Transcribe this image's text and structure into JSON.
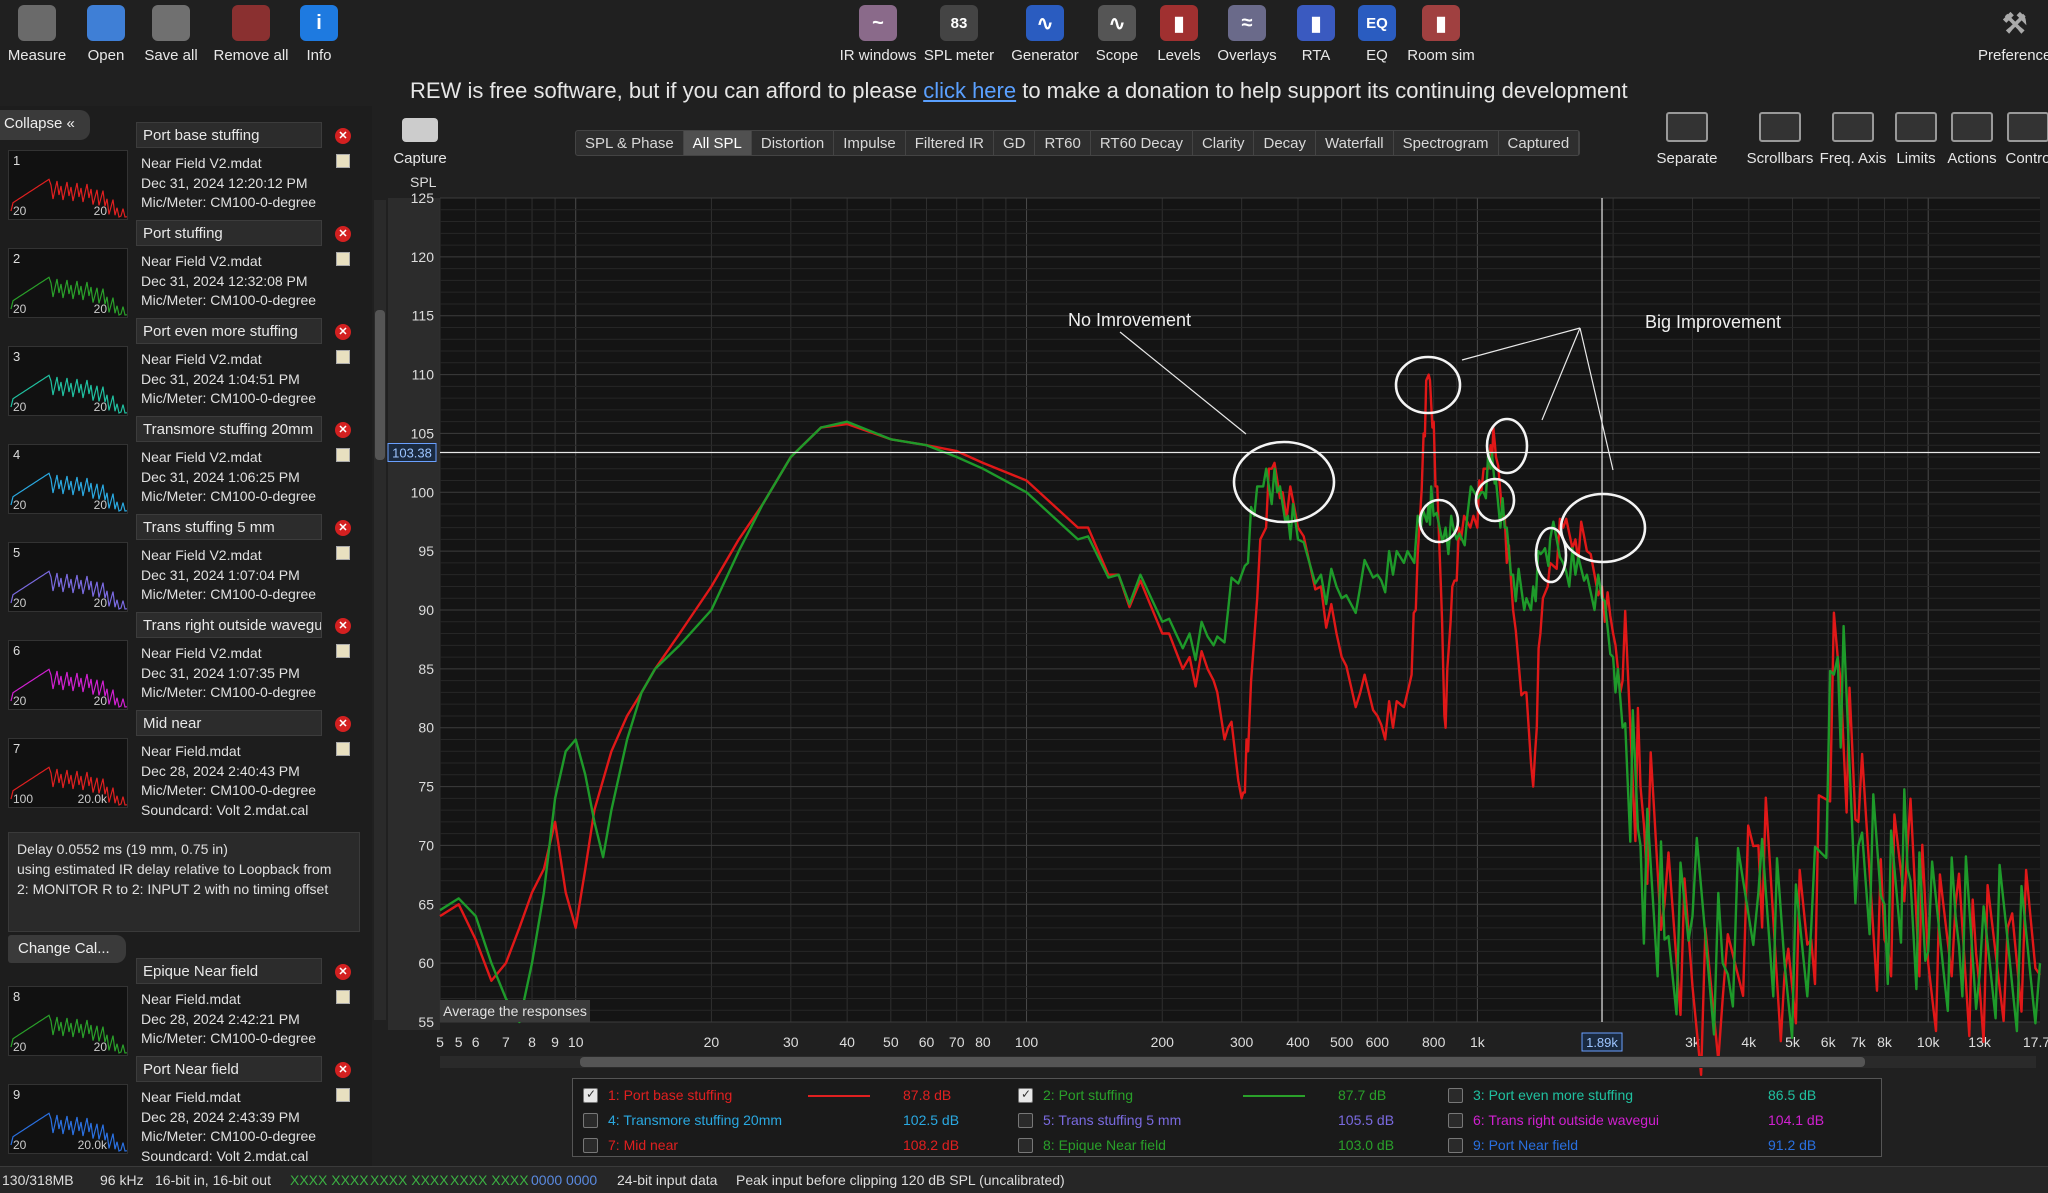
{
  "toolbar_left": [
    {
      "label": "Measure",
      "icon": "measure-icon",
      "color": "#6a6a6a"
    },
    {
      "label": "Open",
      "icon": "folder-icon",
      "color": "#3f7fd6"
    },
    {
      "label": "Save all",
      "icon": "save-icon",
      "color": "#707070"
    },
    {
      "label": "Remove all",
      "icon": "remove-icon",
      "color": "#8a3030"
    },
    {
      "label": "Info",
      "icon": "info-icon",
      "color": "#1e7ae0"
    }
  ],
  "toolbar_center": [
    {
      "label": "IR windows",
      "icon": "ir-windows-icon",
      "color": "#8a6a8a",
      "glyph": "~"
    },
    {
      "label": "SPL meter",
      "icon": "spl-meter-icon",
      "color": "#444",
      "glyph": "83"
    },
    {
      "label": "Generator",
      "icon": "generator-icon",
      "color": "#2a5cc0",
      "glyph": "∿"
    },
    {
      "label": "Scope",
      "icon": "scope-icon",
      "color": "#555",
      "glyph": "∿"
    },
    {
      "label": "Levels",
      "icon": "levels-icon",
      "color": "#a03030",
      "glyph": "▮"
    },
    {
      "label": "Overlays",
      "icon": "overlays-icon",
      "color": "#6a6a8a",
      "glyph": "≈"
    },
    {
      "label": "RTA",
      "icon": "rta-icon",
      "color": "#3a5ac0",
      "glyph": "▮"
    },
    {
      "label": "EQ",
      "icon": "eq-icon",
      "color": "#2a5cc0",
      "glyph": "EQ"
    },
    {
      "label": "Room sim",
      "icon": "room-sim-icon",
      "color": "#a04040",
      "glyph": "▮"
    }
  ],
  "preferences_label": "Preference",
  "donation": {
    "before": "REW is free software, but if you can afford to please ",
    "link": "click here",
    "after": " to make a donation to help support its continuing development"
  },
  "tabs": [
    "SPL & Phase",
    "All SPL",
    "Distortion",
    "Impulse",
    "Filtered IR",
    "GD",
    "RT60",
    "RT60 Decay",
    "Clarity",
    "Decay",
    "Waterfall",
    "Spectrogram",
    "Captured"
  ],
  "active_tab": "All SPL",
  "right_buttons": [
    {
      "label": "Separate",
      "icon": "separate-icon"
    },
    {
      "label": "Scrollbars",
      "icon": "scrollbars-icon"
    },
    {
      "label": "Freq. Axis",
      "icon": "freq-axis-icon"
    },
    {
      "label": "Limits",
      "icon": "limits-icon"
    },
    {
      "label": "Actions",
      "icon": "actions-icon"
    },
    {
      "label": "Contro",
      "icon": "controls-icon"
    }
  ],
  "capture_label": "Capture",
  "collapse_label": "Collapse",
  "measurements": [
    {
      "num": "1",
      "name": "Port base stuffing",
      "file": "Near Field V2.mdat",
      "date": "Dec 31, 2024 12:20:12 PM",
      "mic": "Mic/Meter: CM100-0-degree",
      "color": "#e02020",
      "tl": "20",
      "tr": "20"
    },
    {
      "num": "2",
      "name": "Port stuffing",
      "file": "Near Field V2.mdat",
      "date": "Dec 31, 2024 12:32:08 PM",
      "mic": "Mic/Meter: CM100-0-degree",
      "color": "#2aa02a",
      "tl": "20",
      "tr": "20"
    },
    {
      "num": "3",
      "name": "Port even more stuffing",
      "file": "Near Field V2.mdat",
      "date": "Dec 31, 2024 1:04:51 PM",
      "mic": "Mic/Meter: CM100-0-degree",
      "color": "#20c0a0",
      "tl": "20",
      "tr": "20"
    },
    {
      "num": "4",
      "name": "Transmore stuffing 20mm",
      "file": "Near Field V2.mdat",
      "date": "Dec 31, 2024 1:06:25 PM",
      "mic": "Mic/Meter: CM100-0-degree",
      "color": "#2aa8e0",
      "tl": "20",
      "tr": "20"
    },
    {
      "num": "5",
      "name": "Trans stuffing 5 mm",
      "file": "Near Field V2.mdat",
      "date": "Dec 31, 2024 1:07:04 PM",
      "mic": "Mic/Meter: CM100-0-degree",
      "color": "#7a6ae0",
      "tl": "20",
      "tr": "20"
    },
    {
      "num": "6",
      "name": "Trans right outside wavegu",
      "file": "Near Field V2.mdat",
      "date": "Dec 31, 2024 1:07:35 PM",
      "mic": "Mic/Meter: CM100-0-degree",
      "color": "#d020d0",
      "tl": "20",
      "tr": "20"
    },
    {
      "num": "7",
      "name": "Mid near",
      "file": "Near Field.mdat",
      "date": "Dec 28, 2024 2:40:43 PM",
      "mic": "Mic/Meter: CM100-0-degree",
      "soundcard": "Soundcard: Volt 2.mdat.cal",
      "color": "#e02020",
      "tl": "100",
      "tr": "20.0k"
    },
    {
      "num": "8",
      "name": "Epique Near field",
      "file": "Near Field.mdat",
      "date": "Dec 28, 2024 2:42:21 PM",
      "mic": "Mic/Meter: CM100-0-degree",
      "color": "#2aa02a",
      "tl": "20",
      "tr": "20"
    },
    {
      "num": "9",
      "name": "Port Near field",
      "file": "Near Field.mdat",
      "date": "Dec 28, 2024 2:43:39 PM",
      "mic": "Mic/Meter: CM100-0-degree",
      "soundcard": "Soundcard: Volt 2.mdat.cal",
      "color": "#2a70e0",
      "tl": "20",
      "tr": "20.0k"
    }
  ],
  "delay_text": [
    "Delay 0.0552 ms (19 mm, 0.75 in)",
    "using estimated IR delay relative to Loopback from",
    "2: MONITOR R to 2: INPUT 2 with no timing offset"
  ],
  "change_cal_label": "Change Cal...",
  "average_label": "Average the responses",
  "cursor_readout": {
    "y": "103.38",
    "x": "1.89k"
  },
  "annotations": {
    "left": "No Imrovement",
    "right": "Big Improvement"
  },
  "legend": [
    {
      "num": "1",
      "name": "Port base stuffing",
      "value": "87.8 dB",
      "color": "#e02020",
      "checked": true
    },
    {
      "num": "2",
      "name": "Port stuffing",
      "value": "87.7 dB",
      "color": "#2aa02a",
      "checked": true
    },
    {
      "num": "3",
      "name": "Port even more stuffing",
      "value": "86.5 dB",
      "color": "#20c0a0",
      "checked": false
    },
    {
      "num": "4",
      "name": "Transmore stuffing 20mm",
      "value": "102.5 dB",
      "color": "#2aa8e0",
      "checked": false
    },
    {
      "num": "5",
      "name": "Trans stuffing 5 mm",
      "value": "105.5 dB",
      "color": "#7a6ae0",
      "checked": false
    },
    {
      "num": "6",
      "name": "Trans right outside wavegui",
      "value": "104.1 dB",
      "color": "#d020d0",
      "checked": false
    },
    {
      "num": "7",
      "name": "Mid near",
      "value": "108.2 dB",
      "color": "#e02020",
      "checked": false
    },
    {
      "num": "8",
      "name": "Epique Near field",
      "value": "103.0 dB",
      "color": "#2aa02a",
      "checked": false
    },
    {
      "num": "9",
      "name": "Port Near field",
      "value": "91.2 dB",
      "color": "#2a70e0",
      "checked": false
    }
  ],
  "status": [
    "130/318MB",
    "96 kHz",
    "16-bit in, 16-bit out",
    "XXXX XXXX",
    "XXXX XXXX",
    "XXXX XXXX",
    "0000 0000",
    "24-bit input data",
    "Peak input before clipping 120 dB SPL (uncalibrated)"
  ],
  "chart_data": {
    "type": "line",
    "ylabel": "SPL",
    "xscale": "log",
    "xlim": [
      5,
      17700
    ],
    "ylim": [
      55,
      125
    ],
    "yticks": [
      55,
      60,
      65,
      70,
      75,
      80,
      85,
      90,
      95,
      100,
      105,
      110,
      115,
      120,
      125
    ],
    "xtick_labels": [
      {
        "v": 5,
        "t": "5"
      },
      {
        "v": 5.5,
        "t": "5"
      },
      {
        "v": 6,
        "t": "6"
      },
      {
        "v": 7,
        "t": "7"
      },
      {
        "v": 8,
        "t": "8"
      },
      {
        "v": 9,
        "t": "9"
      },
      {
        "v": 10,
        "t": "10"
      },
      {
        "v": 20,
        "t": "20"
      },
      {
        "v": 30,
        "t": "30"
      },
      {
        "v": 40,
        "t": "40"
      },
      {
        "v": 50,
        "t": "50"
      },
      {
        "v": 60,
        "t": "60"
      },
      {
        "v": 70,
        "t": "70"
      },
      {
        "v": 80,
        "t": "80"
      },
      {
        "v": 100,
        "t": "100"
      },
      {
        "v": 200,
        "t": "200"
      },
      {
        "v": 300,
        "t": "300"
      },
      {
        "v": 400,
        "t": "400"
      },
      {
        "v": 500,
        "t": "500"
      },
      {
        "v": 600,
        "t": "600"
      },
      {
        "v": 800,
        "t": "800"
      },
      {
        "v": 1000,
        "t": "1k"
      },
      {
        "v": 3000,
        "t": "3k"
      },
      {
        "v": 4000,
        "t": "4k"
      },
      {
        "v": 5000,
        "t": "5k"
      },
      {
        "v": 6000,
        "t": "6k"
      },
      {
        "v": 7000,
        "t": "7k"
      },
      {
        "v": 8000,
        "t": "8k"
      },
      {
        "v": 10000,
        "t": "10k"
      },
      {
        "v": 13000,
        "t": "13k"
      },
      {
        "v": 17700,
        "t": "17.7k"
      }
    ],
    "cursor": {
      "x": 1890,
      "y": 103.38
    },
    "series": [
      {
        "name": "1: Port base stuffing",
        "color": "#e01818",
        "points": [
          [
            5,
            64
          ],
          [
            5.5,
            65
          ],
          [
            6,
            62
          ],
          [
            6.5,
            58.5
          ],
          [
            7,
            60
          ],
          [
            7.5,
            63
          ],
          [
            8,
            66
          ],
          [
            8.5,
            68
          ],
          [
            9,
            72
          ],
          [
            9.5,
            66
          ],
          [
            10,
            63
          ],
          [
            10.5,
            68
          ],
          [
            11,
            73
          ],
          [
            12,
            78
          ],
          [
            13,
            81
          ],
          [
            14,
            83
          ],
          [
            15,
            85
          ],
          [
            17,
            88
          ],
          [
            20,
            92
          ],
          [
            23,
            96
          ],
          [
            26,
            99
          ],
          [
            30,
            103
          ],
          [
            35,
            105.5
          ],
          [
            40,
            105.8
          ],
          [
            50,
            104.5
          ],
          [
            60,
            104
          ],
          [
            70,
            103.5
          ],
          [
            80,
            102.5
          ],
          [
            100,
            101
          ],
          [
            130,
            97
          ],
          [
            160,
            93
          ],
          [
            200,
            88
          ],
          [
            230,
            86
          ],
          [
            260,
            84
          ],
          [
            280,
            80
          ],
          [
            300,
            74
          ],
          [
            310,
            78
          ],
          [
            330,
            96
          ],
          [
            350,
            102
          ],
          [
            370,
            100
          ],
          [
            400,
            97
          ],
          [
            450,
            92
          ],
          [
            500,
            86
          ],
          [
            550,
            83
          ],
          [
            600,
            81
          ],
          [
            650,
            80
          ],
          [
            700,
            83
          ],
          [
            730,
            90
          ],
          [
            760,
            105
          ],
          [
            780,
            110
          ],
          [
            800,
            106
          ],
          [
            830,
            92
          ],
          [
            850,
            80
          ],
          [
            880,
            92
          ],
          [
            920,
            96
          ],
          [
            980,
            98
          ],
          [
            1020,
            100
          ],
          [
            1070,
            104
          ],
          [
            1100,
            103
          ],
          [
            1150,
            98
          ],
          [
            1200,
            90
          ],
          [
            1270,
            83
          ],
          [
            1330,
            75
          ],
          [
            1380,
            88
          ],
          [
            1450,
            94
          ],
          [
            1550,
            97
          ],
          [
            1650,
            96
          ],
          [
            1750,
            95
          ],
          [
            1890,
            92
          ],
          [
            2000,
            88
          ],
          [
            2100,
            84
          ],
          [
            2300,
            75
          ],
          [
            2600,
            65
          ],
          [
            3000,
            58
          ],
          [
            3500,
            57
          ],
          [
            4200,
            70
          ],
          [
            4800,
            59
          ],
          [
            5500,
            62
          ],
          [
            6300,
            86
          ],
          [
            7000,
            72
          ],
          [
            8000,
            62
          ],
          [
            9000,
            70
          ],
          [
            10000,
            60
          ],
          [
            11500,
            65
          ],
          [
            13000,
            58
          ],
          [
            15000,
            63
          ],
          [
            17700,
            59
          ]
        ]
      },
      {
        "name": "2: Port stuffing",
        "color": "#1e9a2a",
        "points": [
          [
            5,
            64.5
          ],
          [
            5.5,
            65.5
          ],
          [
            6,
            64
          ],
          [
            6.5,
            60
          ],
          [
            7,
            57
          ],
          [
            7.5,
            55
          ],
          [
            8,
            60
          ],
          [
            8.5,
            66
          ],
          [
            9,
            74
          ],
          [
            9.5,
            78
          ],
          [
            10,
            79
          ],
          [
            10.5,
            76
          ],
          [
            11,
            72
          ],
          [
            11.5,
            69
          ],
          [
            12,
            73
          ],
          [
            13,
            79
          ],
          [
            14,
            83
          ],
          [
            15,
            85
          ],
          [
            17,
            87
          ],
          [
            20,
            90
          ],
          [
            23,
            95
          ],
          [
            26,
            99
          ],
          [
            30,
            103
          ],
          [
            35,
            105.5
          ],
          [
            40,
            106
          ],
          [
            50,
            104.5
          ],
          [
            60,
            104
          ],
          [
            70,
            103
          ],
          [
            80,
            102
          ],
          [
            100,
            100
          ],
          [
            130,
            96
          ],
          [
            160,
            93
          ],
          [
            200,
            89
          ],
          [
            230,
            88
          ],
          [
            260,
            87
          ],
          [
            280,
            90
          ],
          [
            300,
            93
          ],
          [
            320,
            98
          ],
          [
            340,
            102
          ],
          [
            360,
            100
          ],
          [
            380,
            98
          ],
          [
            400,
            96
          ],
          [
            450,
            93
          ],
          [
            500,
            91
          ],
          [
            550,
            92
          ],
          [
            600,
            93
          ],
          [
            650,
            93
          ],
          [
            700,
            95
          ],
          [
            750,
            97
          ],
          [
            780,
            99
          ],
          [
            800,
            98
          ],
          [
            850,
            97
          ],
          [
            900,
            96
          ],
          [
            950,
            98
          ],
          [
            1020,
            100
          ],
          [
            1070,
            102
          ],
          [
            1100,
            101
          ],
          [
            1150,
            97
          ],
          [
            1200,
            93
          ],
          [
            1270,
            90
          ],
          [
            1330,
            92
          ],
          [
            1400,
            95
          ],
          [
            1450,
            96
          ],
          [
            1550,
            94
          ],
          [
            1650,
            93
          ],
          [
            1750,
            93
          ],
          [
            1890,
            91
          ],
          [
            2000,
            86
          ],
          [
            2100,
            80
          ],
          [
            2300,
            70
          ],
          [
            2600,
            62
          ],
          [
            3000,
            64
          ],
          [
            3500,
            60
          ],
          [
            4200,
            66
          ],
          [
            4800,
            60
          ],
          [
            5500,
            63
          ],
          [
            6300,
            86
          ],
          [
            7000,
            70
          ],
          [
            8000,
            65
          ],
          [
            9000,
            68
          ],
          [
            10000,
            61
          ],
          [
            11500,
            64
          ],
          [
            13000,
            59
          ],
          [
            15000,
            62
          ],
          [
            17700,
            60
          ]
        ]
      }
    ]
  }
}
